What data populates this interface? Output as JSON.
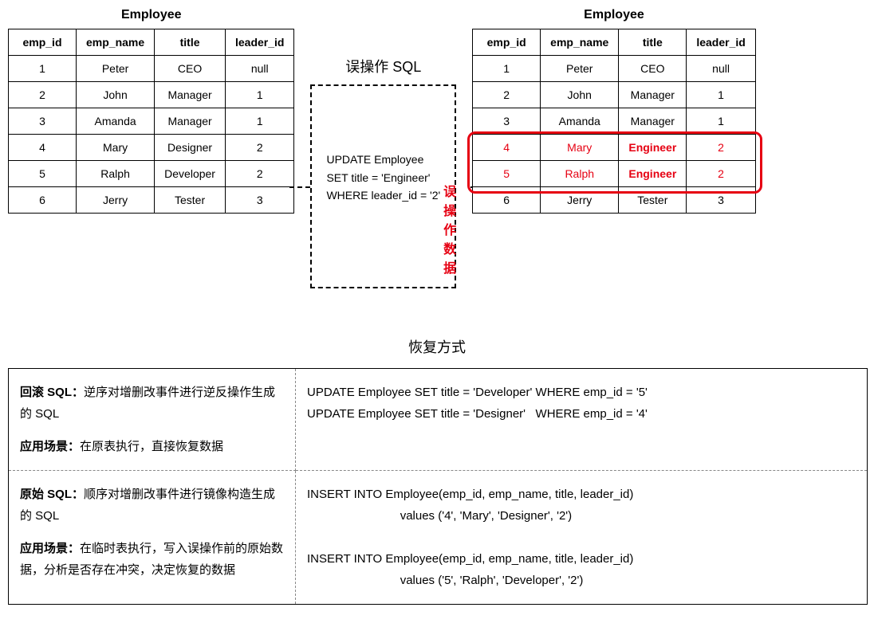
{
  "top": {
    "left_title": "Employee",
    "right_title": "Employee",
    "headers": [
      "emp_id",
      "emp_name",
      "title",
      "leader_id"
    ],
    "left_rows": [
      [
        "1",
        "Peter",
        "CEO",
        "null"
      ],
      [
        "2",
        "John",
        "Manager",
        "1"
      ],
      [
        "3",
        "Amanda",
        "Manager",
        "1"
      ],
      [
        "4",
        "Mary",
        "Designer",
        "2"
      ],
      [
        "5",
        "Ralph",
        "Developer",
        "2"
      ],
      [
        "6",
        "Jerry",
        "Tester",
        "3"
      ]
    ],
    "right_rows": [
      {
        "cells": [
          "1",
          "Peter",
          "CEO",
          "null"
        ],
        "changed": false
      },
      {
        "cells": [
          "2",
          "John",
          "Manager",
          "1"
        ],
        "changed": false
      },
      {
        "cells": [
          "3",
          "Amanda",
          "Manager",
          "1"
        ],
        "changed": false
      },
      {
        "cells": [
          "4",
          "Mary",
          "Engineer",
          "2"
        ],
        "changed": true
      },
      {
        "cells": [
          "5",
          "Ralph",
          "Engineer",
          "2"
        ],
        "changed": true
      },
      {
        "cells": [
          "6",
          "Jerry",
          "Tester",
          "3"
        ],
        "changed": false
      }
    ],
    "sql_title": "误操作 SQL",
    "sql_lines": [
      "UPDATE Employee",
      "SET title = 'Engineer'",
      "WHERE leader_id = '2'"
    ],
    "error_label": "误操作数据"
  },
  "recovery": {
    "title": "恢复方式",
    "rows": [
      {
        "left_title": "回滚 SQL：",
        "left_desc": "逆序对增删改事件进行逆反操作生成的 SQL",
        "scenario_label": "应用场景：",
        "scenario_text": "在原表执行，直接恢复数据",
        "right_lines": [
          "UPDATE Employee SET title = 'Developer' WHERE emp_id = '5'",
          "UPDATE Employee SET title = 'Designer'   WHERE emp_id = '4'"
        ]
      },
      {
        "left_title": "原始 SQL：",
        "left_desc": "顺序对增删改事件进行镜像构造生成的 SQL",
        "scenario_label": "应用场景：",
        "scenario_text": "在临时表执行，写入误操作前的原始数据，分析是否存在冲突，决定恢复的数据",
        "right_lines": [
          "INSERT INTO Employee(emp_id, emp_name, title, leader_id)",
          "                            values ('4', 'Mary', 'Designer', '2')",
          "",
          "INSERT INTO Employee(emp_id, emp_name, title, leader_id)",
          "                            values ('5', 'Ralph', 'Developer', '2')"
        ]
      }
    ]
  }
}
